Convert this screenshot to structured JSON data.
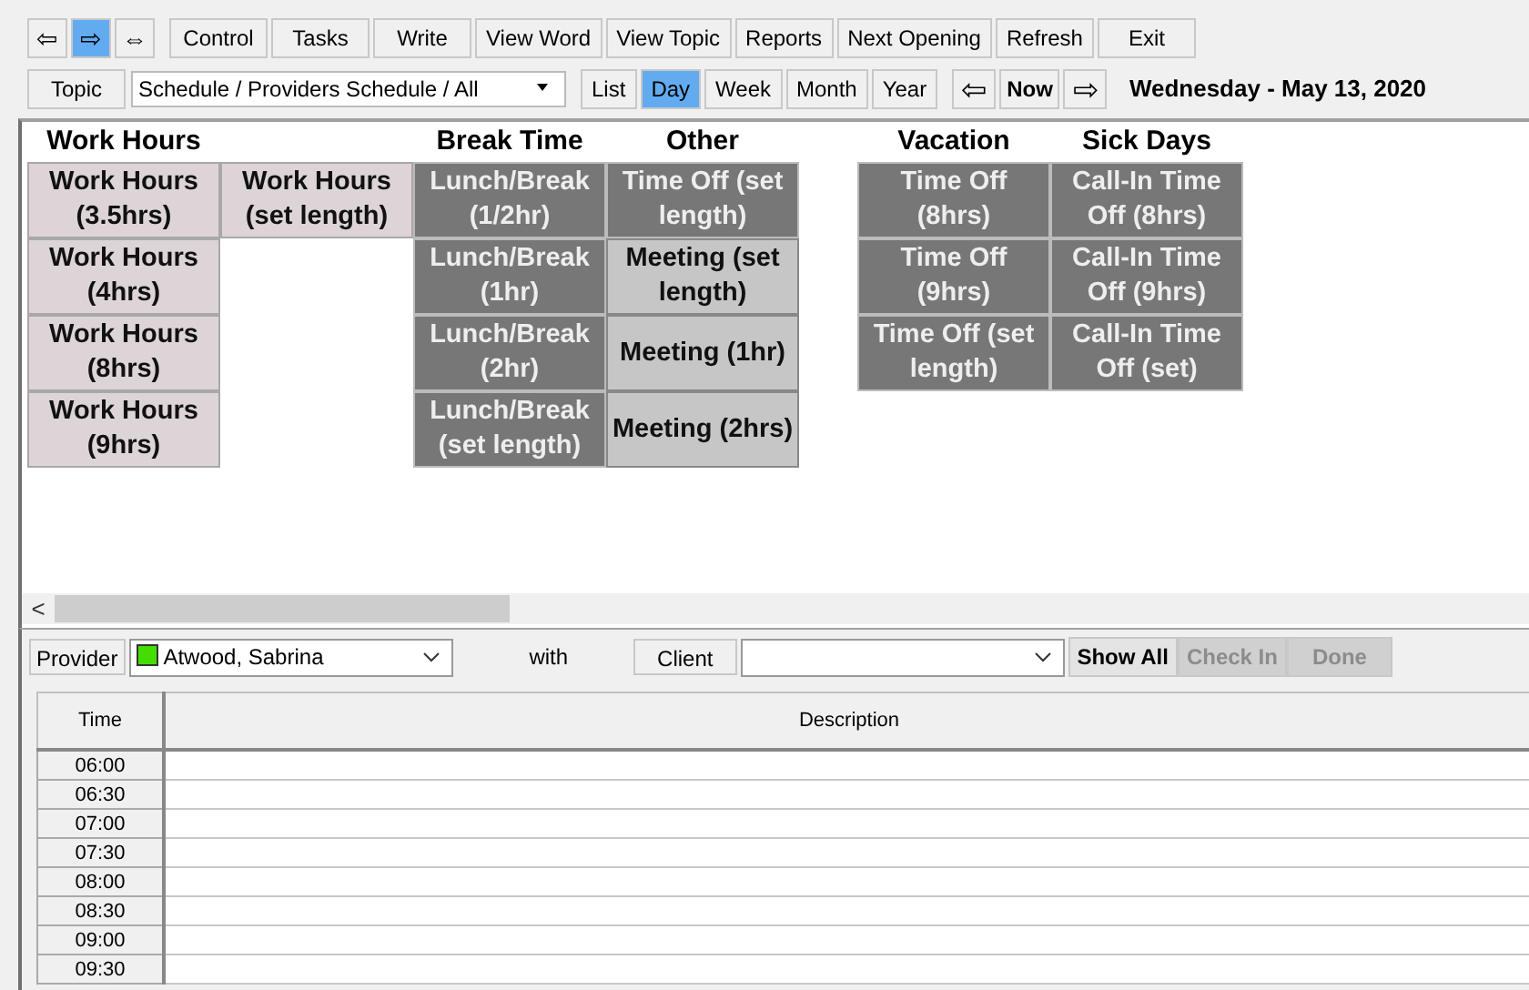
{
  "toolbar": {
    "arrows": [
      {
        "symbol": "⇦",
        "selected": false
      },
      {
        "symbol": "⇨",
        "selected": true
      },
      {
        "symbol": "⇔",
        "selected": false
      }
    ],
    "buttons": [
      "Control",
      "Tasks",
      "Write",
      "View Word",
      "View Topic",
      "Reports",
      "Next Opening",
      "Refresh",
      "Exit"
    ]
  },
  "nav": {
    "topic_button": "Topic",
    "topic_dropdown": "Schedule / Providers Schedule / All",
    "views": [
      {
        "label": "List",
        "selected": false
      },
      {
        "label": "Day",
        "selected": true
      },
      {
        "label": "Week",
        "selected": false
      },
      {
        "label": "Month",
        "selected": false
      },
      {
        "label": "Year",
        "selected": false
      }
    ],
    "prev": "⇦",
    "now": "Now",
    "next": "⇨",
    "date": "Wednesday - May 13, 2020"
  },
  "palette": {
    "groups": [
      {
        "columns": [
          {
            "header": "Work Hours",
            "tiles": [
              {
                "label": "Work Hours (3.5hrs)",
                "kind": "light"
              },
              {
                "label": "Work Hours (4hrs)",
                "kind": "light"
              },
              {
                "label": "Work Hours (8hrs)",
                "kind": "light"
              },
              {
                "label": "Work Hours (9hrs)",
                "kind": "light"
              }
            ]
          },
          {
            "tiles": [
              {
                "label": "Work Hours (set length)",
                "kind": "light"
              }
            ]
          },
          {
            "header": "Break Time",
            "tiles": [
              {
                "label": "Lunch/Break (1/2hr)",
                "kind": "dark"
              },
              {
                "label": "Lunch/Break (1hr)",
                "kind": "dark"
              },
              {
                "label": "Lunch/Break (2hr)",
                "kind": "dark"
              },
              {
                "label": "Lunch/Break (set length)",
                "kind": "dark"
              }
            ]
          },
          {
            "header": "Other",
            "tiles": [
              {
                "label": "Time Off (set length)",
                "kind": "dark"
              },
              {
                "label": "Meeting (set length)",
                "kind": "gray"
              },
              {
                "label": "Meeting (1hr)",
                "kind": "gray"
              },
              {
                "label": "Meeting (2hrs)",
                "kind": "gray"
              }
            ]
          }
        ]
      },
      {
        "columns": [
          {
            "header": "Vacation",
            "tiles": [
              {
                "label": "Time Off (8hrs)",
                "kind": "dark"
              },
              {
                "label": "Time Off (9hrs)",
                "kind": "dark"
              },
              {
                "label": "Time Off (set length)",
                "kind": "dark"
              }
            ]
          },
          {
            "header": "Sick Days",
            "tiles": [
              {
                "label": "Call-In Time Off (8hrs)",
                "kind": "dark"
              },
              {
                "label": "Call-In Time Off (9hrs)",
                "kind": "dark"
              },
              {
                "label": "Call-In Time Off (set)",
                "kind": "dark"
              }
            ]
          }
        ]
      }
    ],
    "scroll_left": "<"
  },
  "provider_bar": {
    "provider_label": "Provider",
    "provider": {
      "value": "Atwood, Sabrina",
      "color": "#44dd00"
    },
    "with": "with",
    "client_label": "Client",
    "buttons": [
      {
        "label": "Show All",
        "disabled": false
      },
      {
        "label": "Check In",
        "disabled": true
      },
      {
        "label": "Done",
        "disabled": true
      }
    ]
  },
  "table": {
    "columns": [
      "Time",
      "Description"
    ],
    "rows": [
      {
        "time": "06:00"
      },
      {
        "time": "06:30"
      },
      {
        "time": "07:00"
      },
      {
        "time": "07:30"
      },
      {
        "time": "08:00"
      },
      {
        "time": "08:30"
      },
      {
        "time": "09:00"
      },
      {
        "time": "09:30"
      }
    ]
  }
}
